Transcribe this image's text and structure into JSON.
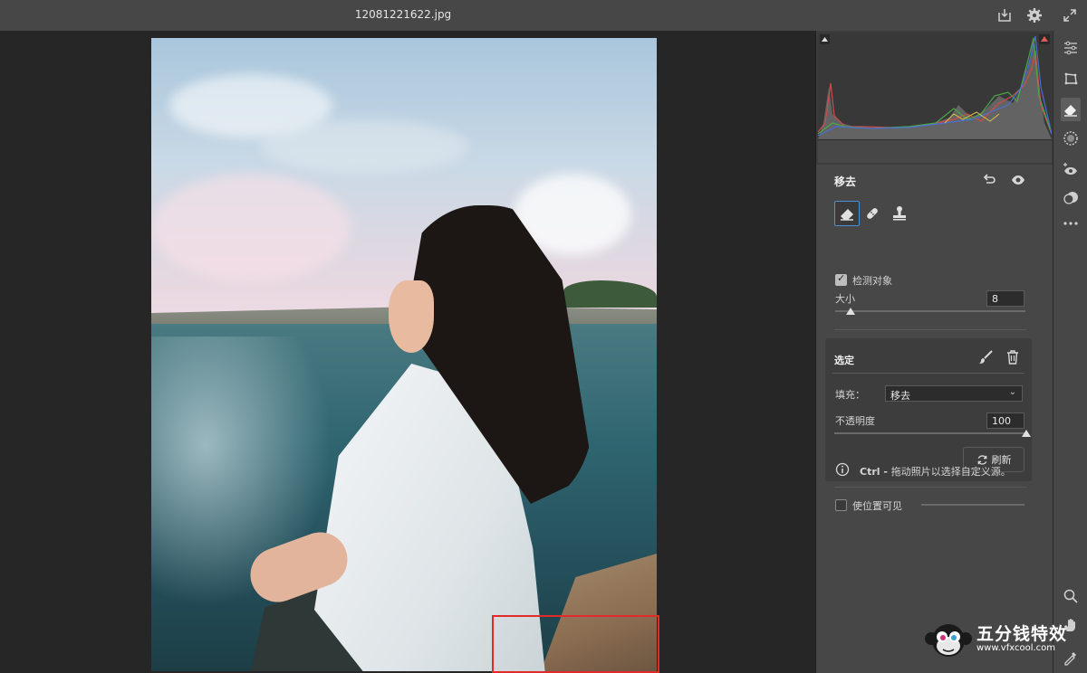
{
  "title_bar": {
    "filename": "12081221622.jpg",
    "icons": [
      "save-download-icon",
      "settings-gear-icon",
      "expand-icon"
    ]
  },
  "panel": {
    "section_title": "移去",
    "tools": [
      "content-aware-remove-icon",
      "heal-icon",
      "clone-stamp-icon"
    ],
    "detect_objects": {
      "label": "检测对象",
      "checked": true
    },
    "size": {
      "label": "大小",
      "value": "8",
      "level": 0.08
    },
    "selection": {
      "title": "选定",
      "fill_label": "填充：",
      "fill_value": "移去",
      "opacity_label": "不透明度",
      "opacity_value": "100",
      "opacity_level": 1.0,
      "refresh_label": "刷新"
    },
    "tip": {
      "bold": "Ctrl - ",
      "text": "拖动照片以选择自定义源。"
    },
    "show_overlay": {
      "label": "使位置可见",
      "checked": false
    }
  },
  "colors": {
    "accent": "#4d8edb",
    "selection_rect": "#e22a2a",
    "clip_warning": "#e05a5a"
  },
  "watermark": {
    "text": "五分钱特效",
    "url": "www.vfxcool.com"
  }
}
